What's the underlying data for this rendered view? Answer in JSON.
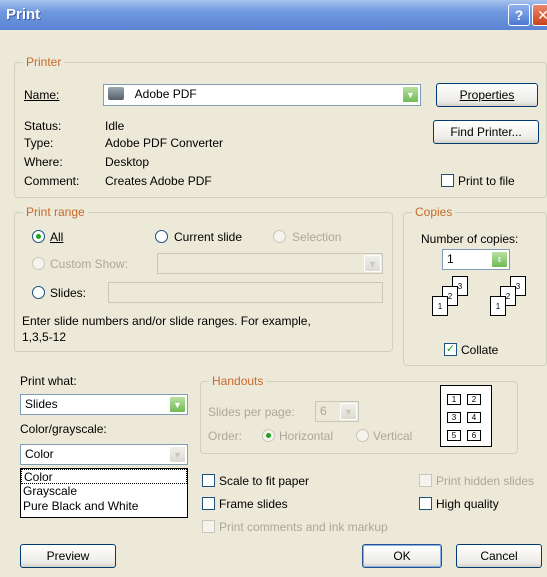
{
  "window": {
    "title": "Print"
  },
  "printer": {
    "legend": "Printer",
    "name_label": "Name:",
    "name_value": "Adobe PDF",
    "status_label": "Status:",
    "status_value": "Idle",
    "type_label": "Type:",
    "type_value": "Adobe PDF Converter",
    "where_label": "Where:",
    "where_value": "Desktop",
    "comment_label": "Comment:",
    "comment_value": "Creates Adobe PDF",
    "properties_button": "Properties",
    "find_printer_button": "Find Printer...",
    "print_to_file": "Print to file"
  },
  "print_range": {
    "legend": "Print range",
    "all": "All",
    "current_slide": "Current slide",
    "selection": "Selection",
    "custom_show": "Custom Show:",
    "slides": "Slides:",
    "hint_line1": "Enter slide numbers and/or slide ranges. For example,",
    "hint_line2": "1,3,5-12"
  },
  "copies": {
    "legend": "Copies",
    "number_label": "Number of copies:",
    "number_value": "1",
    "collate": "Collate"
  },
  "print_what": {
    "label": "Print what:",
    "value": "Slides"
  },
  "color": {
    "label": "Color/grayscale:",
    "value": "Color",
    "options": [
      "Color",
      "Grayscale",
      "Pure Black and White"
    ]
  },
  "handouts": {
    "legend": "Handouts",
    "slides_per_page_label": "Slides per page:",
    "slides_per_page_value": "6",
    "order_label": "Order:",
    "horizontal": "Horizontal",
    "vertical": "Vertical",
    "preview": [
      "1",
      "2",
      "3",
      "4",
      "5",
      "6"
    ]
  },
  "options": {
    "scale_to_fit": "Scale to fit paper",
    "frame_slides": "Frame slides",
    "print_comments": "Print comments and ink markup",
    "print_hidden": "Print hidden slides",
    "high_quality": "High quality"
  },
  "buttons": {
    "preview": "Preview",
    "ok": "OK",
    "cancel": "Cancel"
  }
}
